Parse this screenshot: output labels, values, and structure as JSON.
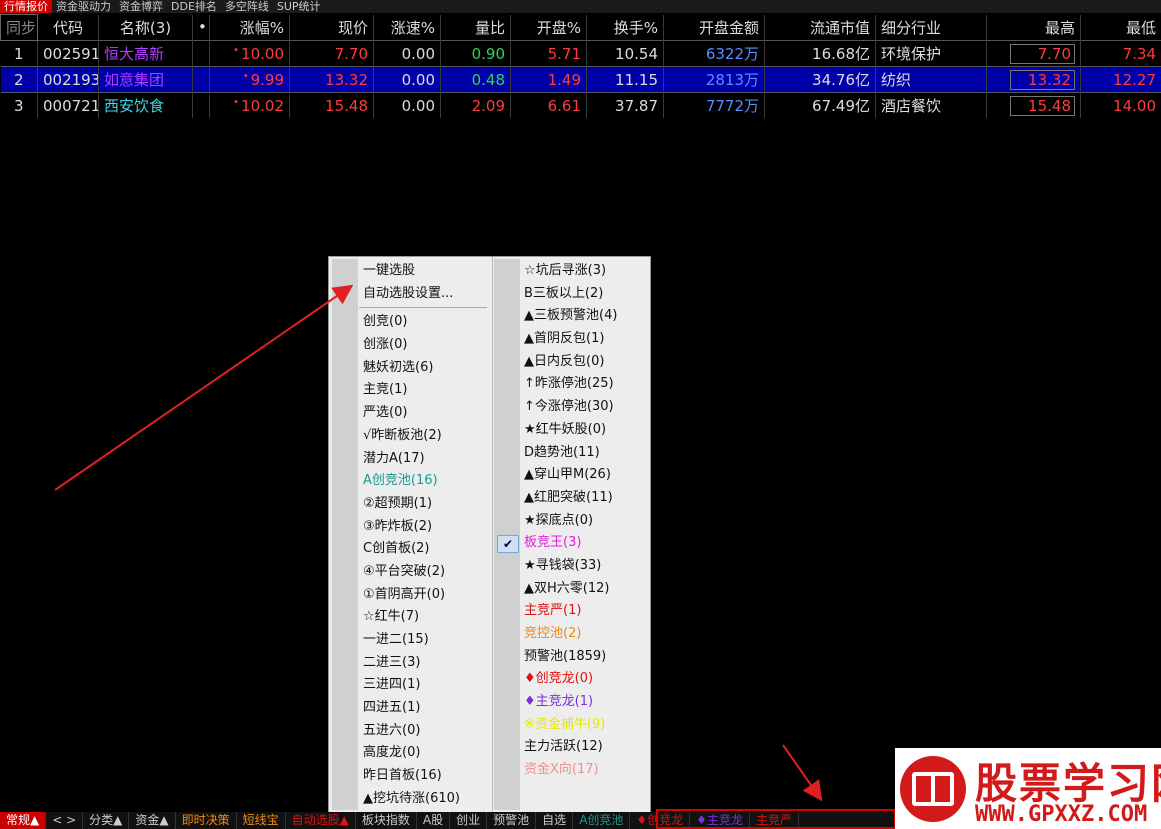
{
  "top_tabs": [
    "行情报价",
    "资金驱动力",
    "资金博弈",
    "DDE排名",
    "多空阵线",
    "SUP统计"
  ],
  "table": {
    "headers": [
      "同步",
      "代码",
      "名称(3)",
      "•",
      "涨幅%",
      "现价",
      "涨速%",
      "量比",
      "开盘%",
      "换手%",
      "开盘金额",
      "流通市值",
      "细分行业",
      "最高",
      "最低"
    ],
    "rows": [
      {
        "idx": "1",
        "code": "002591",
        "name": "恒大高新",
        "chg": "10.00",
        "price": "7.70",
        "speed": "0.00",
        "vol_ratio": "0.90",
        "open_pct": "5.71",
        "turnover": "10.54",
        "open_amt": "6322万",
        "mkt_cap": "16.68亿",
        "industry": "环境保护",
        "high": "7.70",
        "low": "7.34"
      },
      {
        "idx": "2",
        "code": "002193",
        "name": "如意集团",
        "chg": "9.99",
        "price": "13.32",
        "speed": "0.00",
        "vol_ratio": "0.48",
        "open_pct": "1.49",
        "turnover": "11.15",
        "open_amt": "2813万",
        "mkt_cap": "34.76亿",
        "industry": "纺织",
        "high": "13.32",
        "low": "12.27"
      },
      {
        "idx": "3",
        "code": "000721",
        "name": "西安饮食",
        "chg": "10.02",
        "price": "15.48",
        "speed": "0.00",
        "vol_ratio": "2.09",
        "open_pct": "6.61",
        "turnover": "37.87",
        "open_amt": "7772万",
        "mkt_cap": "67.49亿",
        "industry": "酒店餐饮",
        "high": "15.48",
        "low": "14.00"
      }
    ]
  },
  "menu": {
    "left_top": [
      "一键选股",
      "自动选股设置..."
    ],
    "left": [
      "创竞(0)",
      "创涨(0)",
      "魅妖初选(6)",
      "主竞(1)",
      "严选(0)",
      "√昨断板池(2)",
      "潜力A(17)",
      "A创竞池(16)",
      "②超预期(1)",
      "③昨炸板(2)",
      "C创首板(2)",
      "④平台突破(2)",
      "①首阴高开(0)",
      "☆红牛(7)",
      "一进二(15)",
      "二进三(3)",
      "三进四(1)",
      "四进五(1)",
      "五进六(0)",
      "高度龙(0)",
      "昨日首板(16)",
      "▲挖坑待涨(610)"
    ],
    "right": [
      "☆坑后寻涨(3)",
      "B三板以上(2)",
      "▲三板预警池(4)",
      "▲首阴反包(1)",
      "▲日内反包(0)",
      "↑昨涨停池(25)",
      "↑今涨停池(30)",
      "★红牛妖股(0)",
      "D趋势池(11)",
      "▲穿山甲M(26)",
      "▲红肥突破(11)",
      "★探底点(0)",
      "板竞王(3)",
      "★寻钱袋(33)",
      "▲双H六零(12)",
      "主竞严(1)",
      "竞控池(2)",
      "预警池(1859)",
      "♦创竞龙(0)",
      "♦主竞龙(1)",
      "※资金捕牛(9)",
      "主力活跃(12)",
      "资金X向(17)"
    ],
    "checked_label": "✔"
  },
  "bottom_tabs": [
    "常规▲",
    "< >",
    "分类▲",
    "资金▲",
    "即时决策",
    "短线宝",
    "自动选股▲",
    "板块指数",
    "A股",
    "创业",
    "预警池",
    "自选",
    "A创竞池",
    "♦创竞龙",
    "♦主竞龙",
    "主竞严"
  ],
  "watermark": {
    "title": "股票学习网",
    "url": "WWW.GPXXZ.COM"
  },
  "colors": {
    "red": "#ff3b3b",
    "green": "#2fd35a",
    "purple": "#b03cff",
    "cyan": "#35d8e8",
    "blue_value": "#5a8cff",
    "selected_row": "#0000a8",
    "teal": "#1a9a8a",
    "magenta": "#e020e0",
    "orange": "#f08a10",
    "yellow": "#e8e800",
    "pink": "#f09090",
    "violet": "#7a30e0",
    "crimson": "#e01010"
  }
}
